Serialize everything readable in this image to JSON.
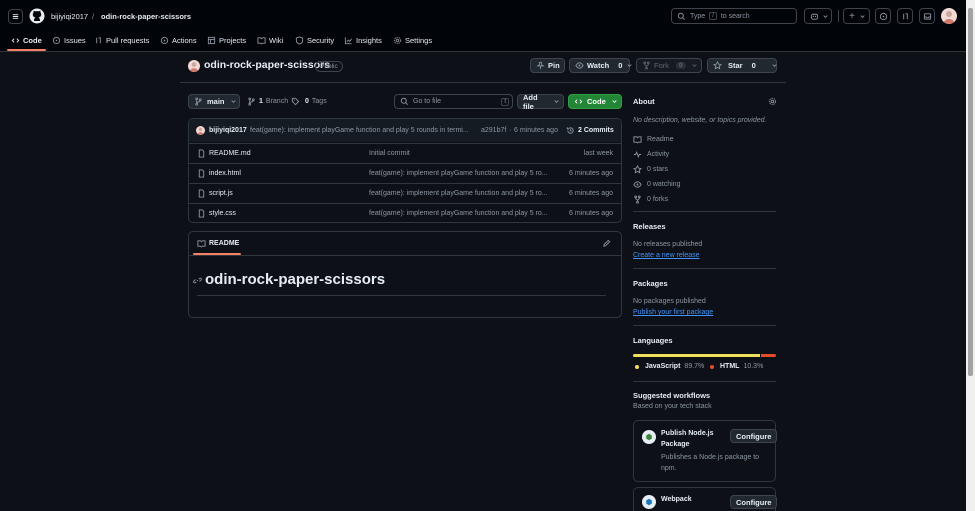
{
  "header": {
    "owner": "bijiyiqi2017",
    "separator": "/",
    "repo": "odin-rock-paper-scissors",
    "search_placeholder_prefix": "Type",
    "search_key": "/",
    "search_placeholder_suffix": "to search",
    "plus_label": "+"
  },
  "tabs": [
    {
      "label": "Code"
    },
    {
      "label": "Issues"
    },
    {
      "label": "Pull requests"
    },
    {
      "label": "Actions"
    },
    {
      "label": "Projects"
    },
    {
      "label": "Wiki"
    },
    {
      "label": "Security"
    },
    {
      "label": "Insights"
    },
    {
      "label": "Settings"
    }
  ],
  "repo": {
    "name": "odin-rock-paper-scissors",
    "visibility": "Public",
    "pin_label": "Pin",
    "watch_label": "Watch",
    "watch_count": "0",
    "fork_label": "Fork",
    "fork_count": "0",
    "star_label": "Star",
    "star_count": "0"
  },
  "toolbar": {
    "branch": "main",
    "branch_count": "1",
    "branch_label": "Branch",
    "tag_count": "0",
    "tag_label": "Tags",
    "goto_placeholder": "Go to file",
    "goto_key": "t",
    "add_file_label": "Add file",
    "code_label": "Code"
  },
  "commit": {
    "author": "bijiyiqi2017",
    "message": "feat(game): implement playGame function and play 5 rounds in termi...",
    "hash": "a291b7f",
    "dot": "·",
    "time": "6 minutes ago",
    "commit_count": "2 Commits"
  },
  "files": [
    {
      "name": "README.md",
      "message": "Initial commit",
      "time": "last week"
    },
    {
      "name": "index.html",
      "message": "feat(game): implement playGame function and play 5 ro...",
      "time": "6 minutes ago"
    },
    {
      "name": "script.js",
      "message": "feat(game): implement playGame function and play 5 ro...",
      "time": "6 minutes ago"
    },
    {
      "name": "style.css",
      "message": "feat(game): implement playGame function and play 5 ro...",
      "time": "6 minutes ago"
    }
  ],
  "readme": {
    "tab_label": "README",
    "heading": "odin-rock-paper-scissors"
  },
  "about": {
    "title": "About",
    "description": "No description, website, or topics provided.",
    "items": [
      {
        "icon": "book-icon",
        "label": "Readme"
      },
      {
        "icon": "pulse-icon",
        "label": "Activity"
      },
      {
        "icon": "star-icon",
        "label": "0 stars"
      },
      {
        "icon": "eye-icon",
        "label": "0 watching"
      },
      {
        "icon": "fork-icon",
        "label": "0 forks"
      }
    ]
  },
  "releases": {
    "title": "Releases",
    "text": "No releases published",
    "link": "Create a new release"
  },
  "packages": {
    "title": "Packages",
    "text": "No packages published",
    "link": "Publish your first package"
  },
  "languages": {
    "title": "Languages",
    "items": [
      {
        "name": "JavaScript",
        "percent": "89.7%",
        "value": 89.7,
        "color": "#f1e05a"
      },
      {
        "name": "HTML",
        "percent": "10.3%",
        "value": 10.3,
        "color": "#e34c26"
      }
    ]
  },
  "workflows": {
    "title": "Suggested workflows",
    "subtitle": "Based on your tech stack",
    "cards": [
      {
        "title_line1": "Publish Node.js",
        "title_line2": "Package",
        "desc_line1": "Publishes a Node.js package to",
        "desc_line2": "npm.",
        "button": "Configure"
      },
      {
        "title_line1": "Webpack",
        "button": "Configure"
      }
    ]
  }
}
